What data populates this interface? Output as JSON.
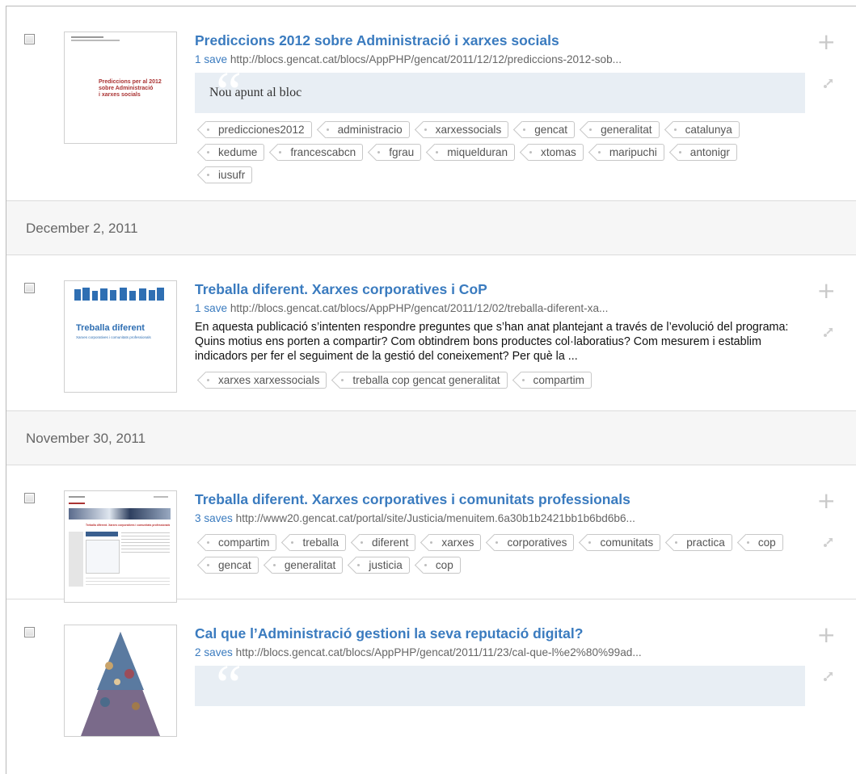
{
  "bookmarks_top": {
    "title": "Prediccions 2012 sobre Administració i xarxes socials",
    "saves": "1 save",
    "url": "http://blocs.gencat.cat/blocs/AppPHP/gencat/2011/12/12/prediccions-2012-sob...",
    "note": "Nou apunt al bloc",
    "thumb_text": [
      "Prediccions per al 2012",
      "sobre Administració",
      "i xarxes socials"
    ],
    "tags": [
      "predicciones2012",
      "administracio",
      "xarxessocials",
      "gencat",
      "generalitat",
      "catalunya",
      "kedume",
      "francescabcn",
      "fgrau",
      "miquelduran",
      "xtomas",
      "maripuchi",
      "antonigr",
      "iusufr"
    ]
  },
  "date1": "December 2, 2011",
  "bookmark2": {
    "title": "Treballa diferent. Xarxes corporatives i CoP",
    "saves": "1 save",
    "url": "http://blocs.gencat.cat/blocs/AppPHP/gencat/2011/12/02/treballa-diferent-xa...",
    "description": "En aquesta publicació s’intenten respondre preguntes que s’han anat plantejant a través de l’evolució del programa: Quins motius ens porten a compartir? Com obtindrem bons productes col·laboratius? Com mesurem i establim indicadors per fer el seguiment de la gestió del coneixement? Per què la ...",
    "thumb_title": "Treballa diferent",
    "thumb_sub": "Xarxes corporatives i comunitats professionals",
    "tags": [
      "xarxes xarxessocials",
      "treballa cop gencat generalitat",
      "compartim"
    ]
  },
  "date2": "November 30, 2011",
  "bookmark3": {
    "title": "Treballa diferent. Xarxes corporatives i comunitats professionals",
    "saves": "3 saves",
    "url": "http://www20.gencat.cat/portal/site/Justicia/menuitem.6a30b1b2421bb1b6bd6b6...",
    "thumb_heading": "Treballa diferent. Xarxes corporatives i comunitats professionals",
    "tags": [
      "compartim",
      "treballa",
      "diferent",
      "xarxes",
      "corporatives",
      "comunitats",
      "practica",
      "cop",
      "gencat",
      "generalitat",
      "justicia",
      "cop"
    ]
  },
  "bookmark4": {
    "title": "Cal que l’Administració gestioni la seva reputació digital?",
    "saves": "2 saves",
    "url": "http://blocs.gencat.cat/blocs/AppPHP/gencat/2011/11/23/cal-que-l%e2%80%99ad..."
  },
  "icons": {
    "add": "plus-icon",
    "share": "share-arrow-icon"
  },
  "colors": {
    "link": "#3a7bbf",
    "note_bg": "#e8eef4",
    "date_bg": "#f6f6f6"
  }
}
